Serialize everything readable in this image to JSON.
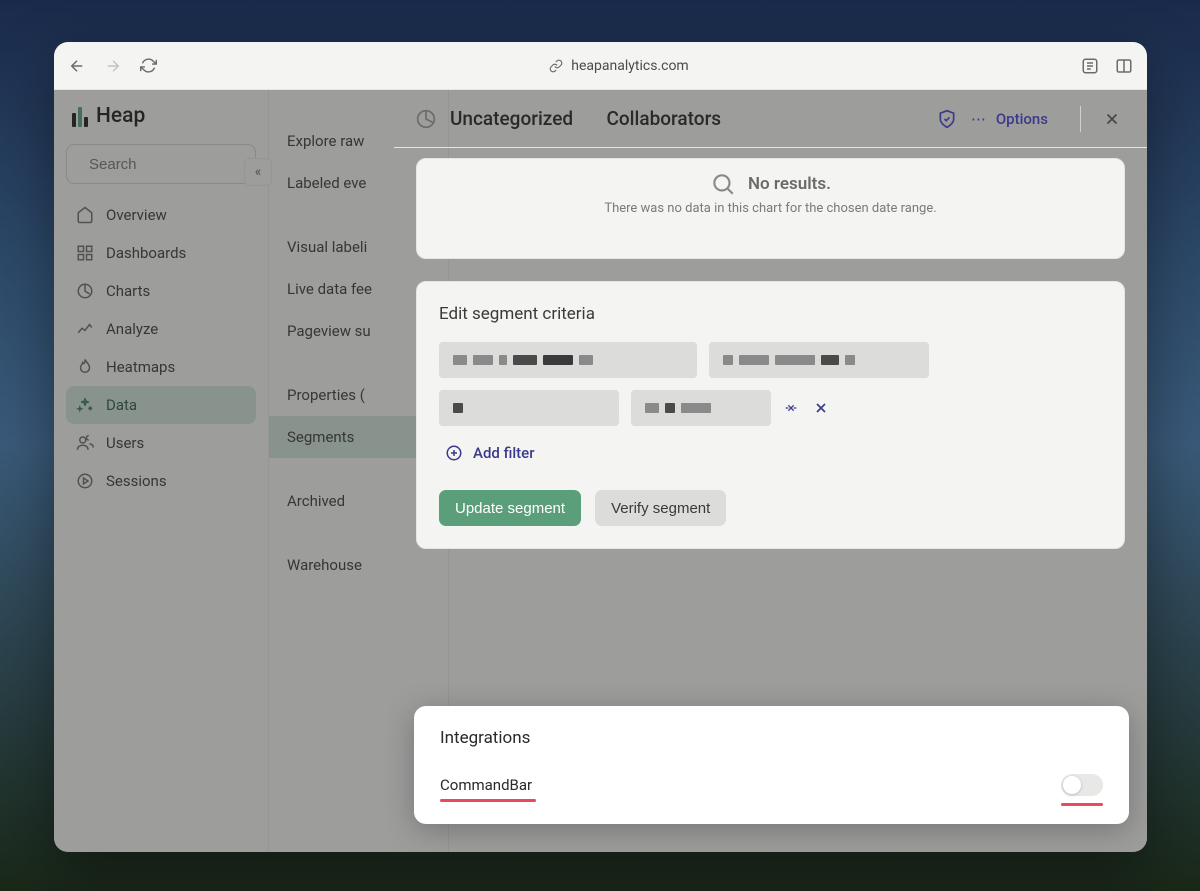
{
  "browser": {
    "url": "heapanalytics.com"
  },
  "logo": {
    "text": "Heap"
  },
  "search": {
    "placeholder": "Search"
  },
  "nav": {
    "items": [
      {
        "label": "Overview"
      },
      {
        "label": "Dashboards"
      },
      {
        "label": "Charts"
      },
      {
        "label": "Analyze"
      },
      {
        "label": "Heatmaps"
      },
      {
        "label": "Data"
      },
      {
        "label": "Users"
      },
      {
        "label": "Sessions"
      }
    ],
    "active_index": 5
  },
  "subnav": {
    "items": [
      "Explore raw",
      "Labeled eve",
      "Visual labeli",
      "Live data fee",
      "Pageview su",
      "Properties (",
      "Segments",
      "Archived",
      "Warehouse"
    ],
    "active_index": 6
  },
  "header": {
    "breadcrumb": [
      "Uncategorized",
      "Collaborators"
    ],
    "options_label": "Options"
  },
  "chart": {
    "no_results_title": "No results.",
    "no_results_sub": "There was no data in this chart for the chosen date range."
  },
  "segment": {
    "title": "Edit segment criteria",
    "add_filter_label": "Add filter",
    "update_label": "Update segment",
    "verify_label": "Verify segment"
  },
  "integrations": {
    "title": "Integrations",
    "item_name": "CommandBar",
    "toggle_on": false
  }
}
